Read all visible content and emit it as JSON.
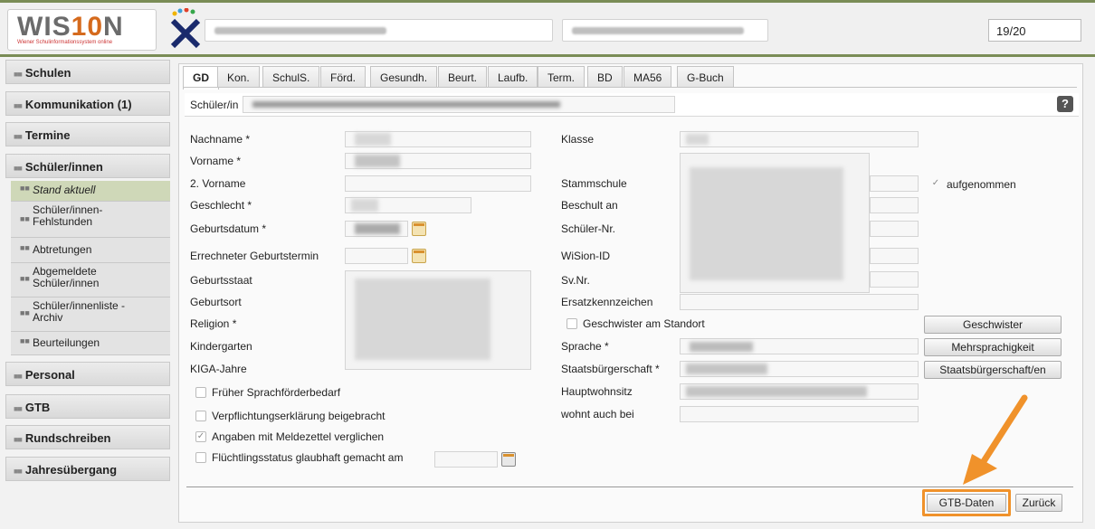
{
  "header": {
    "school_year": "19/20",
    "logo_text": "WISION",
    "logo_badge": "10",
    "logo_subtitle": "Wiener Schulinformationssystem online"
  },
  "sidebar": {
    "items": [
      {
        "label": "Schulen"
      },
      {
        "label": "Kommunikation (1)"
      },
      {
        "label": "Termine"
      },
      {
        "label": "Schüler/innen"
      },
      {
        "label": "Personal"
      },
      {
        "label": "GTB"
      },
      {
        "label": "Rundschreiben"
      },
      {
        "label": "Jahresübergang"
      }
    ],
    "sub_items": [
      {
        "label": "Stand aktuell"
      },
      {
        "label": "Schüler/innen-\nFehlstunden"
      },
      {
        "label": "Abtretungen"
      },
      {
        "label": "Abgemeldete\nSchüler/innen"
      },
      {
        "label": "Schüler/innenliste -\nArchiv"
      },
      {
        "label": "Beurteilungen"
      }
    ]
  },
  "tabs": [
    "GD",
    "Kon.",
    "SchulS.",
    "Förd.",
    "Gesundh.",
    "Beurt.",
    "Laufb.",
    "Term.",
    "BD",
    "MA56",
    "G-Buch"
  ],
  "student_label": "Schüler/in",
  "help": "?",
  "form": {
    "left_labels": [
      "Nachname *",
      "Vorname *",
      "2. Vorname",
      "Geschlecht *",
      "Geburtsdatum *",
      "Errechneter Geburtstermin",
      "Geburtsstaat",
      "Geburtsort",
      "Religion *",
      "Kindergarten",
      "KIGA-Jahre"
    ],
    "right_labels": [
      "Klasse",
      "Stammschule",
      "Beschult an",
      "Schüler-Nr.",
      "WiSion-ID",
      "Sv.Nr.",
      "Ersatzkennzeichen",
      "Sprache *",
      "Staatsbürgerschaft *",
      "Hauptwohnsitz",
      "wohnt auch bei"
    ],
    "geschwister_checkbox": "Geschwister am Standort",
    "aufgenommen": "aufgenommen",
    "checkboxes": [
      {
        "label": "Früher Sprachförderbedarf",
        "checked": false
      },
      {
        "label": "Verpflichtungserklärung beigebracht",
        "checked": false
      },
      {
        "label": "Angaben mit Meldezettel verglichen",
        "checked": true
      },
      {
        "label": "Flüchtlingsstatus glaubhaft gemacht am",
        "checked": false
      }
    ]
  },
  "buttons": {
    "geschwister": "Geschwister",
    "mehrsprachigkeit": "Mehrsprachigkeit",
    "staatsbuergerschaft": "Staatsbürgerschaft/en",
    "gtb_daten": "GTB-Daten",
    "zurueck": "Zurück"
  },
  "colors": {
    "accent": "#7a8c56",
    "highlight": "#f0922b"
  }
}
